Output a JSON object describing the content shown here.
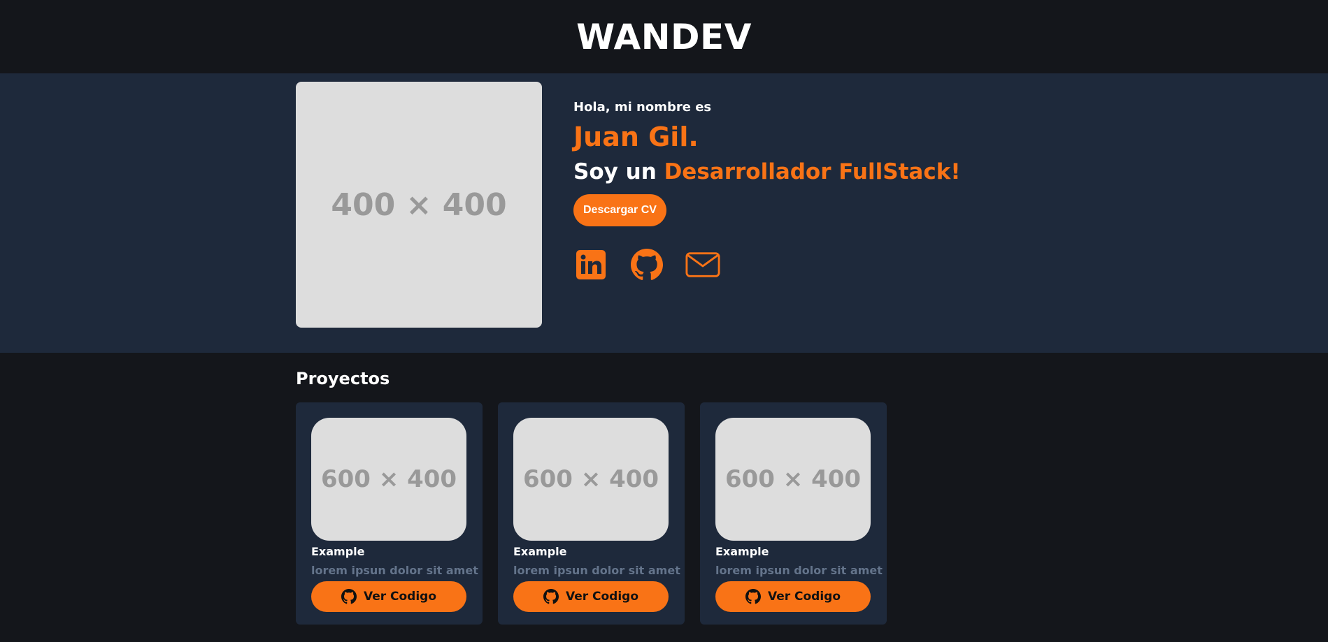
{
  "header": {
    "brand": "WANDEV"
  },
  "hero": {
    "avatar_placeholder": "400 × 400",
    "greeting": "Hola, mi nombre es",
    "name": "Juan Gil.",
    "role_prefix": "Soy un",
    "role_highlight": "Desarrollador FullStack!",
    "cv_button": "Descargar CV",
    "socials": [
      {
        "icon": "linkedin-icon"
      },
      {
        "icon": "github-icon"
      },
      {
        "icon": "mail-icon"
      }
    ]
  },
  "projects": {
    "title": "Proyectos",
    "cards": [
      {
        "image_placeholder": "600 × 400",
        "title": "Example",
        "description": "lorem ipsun dolor sit amet",
        "button": "Ver Codigo"
      },
      {
        "image_placeholder": "600 × 400",
        "title": "Example",
        "description": "lorem ipsun dolor sit amet",
        "button": "Ver Codigo"
      },
      {
        "image_placeholder": "600 × 400",
        "title": "Example",
        "description": "lorem ipsun dolor sit amet",
        "button": "Ver Codigo"
      }
    ]
  },
  "colors": {
    "background": "#14161b",
    "panel": "#1e293b",
    "accent": "#f97316",
    "muted_text": "#64748b",
    "placeholder": "#dddddd"
  }
}
